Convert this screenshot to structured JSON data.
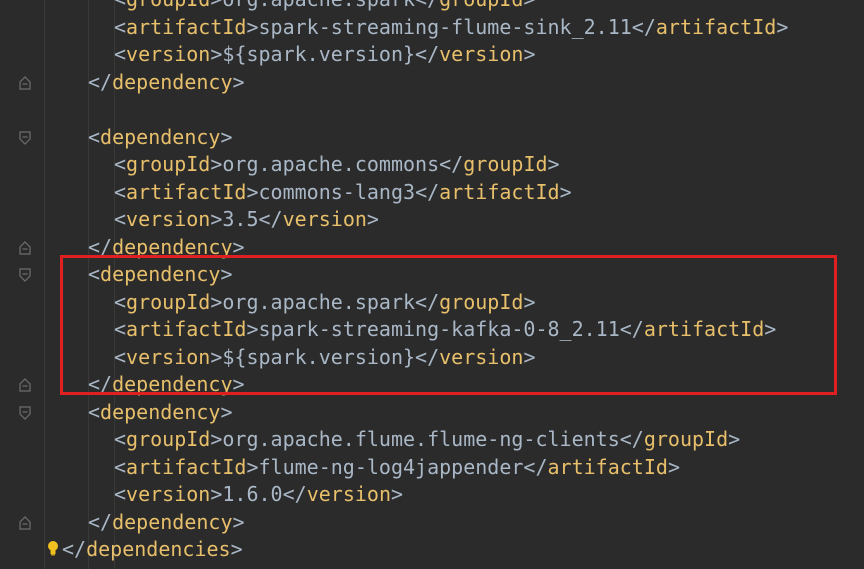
{
  "accent": {
    "tag_color": "#e8bf6a",
    "text_color": "#a9b7c6",
    "highlight_color": "#e02020",
    "background": "#2b2b2b"
  },
  "lines": [
    {
      "open": "groupId",
      "text": "org.apache.spark",
      "close": "groupId",
      "indent": 2
    },
    {
      "open": "artifactId",
      "text": "spark-streaming-flume-sink_2.11",
      "close": "artifactId",
      "indent": 2
    },
    {
      "open": "version",
      "text": "${spark.version}",
      "close": "version",
      "indent": 2
    },
    {
      "end": "dependency",
      "indent": 1
    },
    {
      "blank": true
    },
    {
      "start": "dependency",
      "indent": 1
    },
    {
      "open": "groupId",
      "text": "org.apache.commons",
      "close": "groupId",
      "indent": 2
    },
    {
      "open": "artifactId",
      "text": "commons-lang3",
      "close": "artifactId",
      "indent": 2
    },
    {
      "open": "version",
      "text": "3.5",
      "close": "version",
      "indent": 2
    },
    {
      "end": "dependency",
      "indent": 1
    },
    {
      "start": "dependency",
      "indent": 1
    },
    {
      "open": "groupId",
      "text": "org.apache.spark",
      "close": "groupId",
      "indent": 2
    },
    {
      "open": "artifactId",
      "text": "spark-streaming-kafka-0-8_2.11",
      "close": "artifactId",
      "indent": 2
    },
    {
      "open": "version",
      "text": "${spark.version}",
      "close": "version",
      "indent": 2
    },
    {
      "end": "dependency",
      "indent": 1
    },
    {
      "start": "dependency",
      "indent": 1
    },
    {
      "open": "groupId",
      "text": "org.apache.flume.flume-ng-clients",
      "close": "groupId",
      "indent": 2
    },
    {
      "open": "artifactId",
      "text": "flume-ng-log4jappender",
      "close": "artifactId",
      "indent": 2
    },
    {
      "open": "version",
      "text": "1.6.0",
      "close": "version",
      "indent": 2
    },
    {
      "end": "dependency",
      "indent": 1
    },
    {
      "end": "dependencies",
      "indent": 0
    }
  ],
  "gutter": {
    "fold_icon": "fold-marker-icon",
    "bulb_icon": "lightbulb-icon"
  }
}
